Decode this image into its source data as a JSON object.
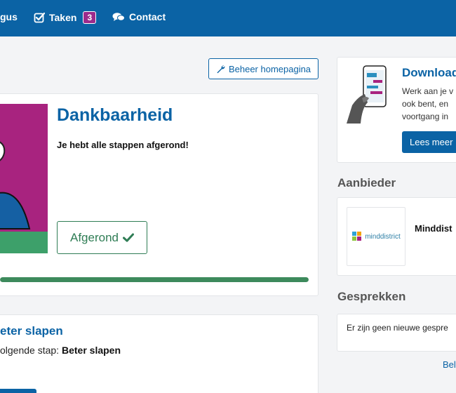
{
  "nav": {
    "items": [
      {
        "label": "gus",
        "icon": "none"
      },
      {
        "label": "Taken",
        "icon": "check-square-icon",
        "badge": "3"
      },
      {
        "label": "Contact",
        "icon": "chat-bubbles-icon"
      }
    ]
  },
  "toolbar": {
    "beheer_label": "Beheer homepagina"
  },
  "course": {
    "title": "Dankbaarheid",
    "message": "Je hebt alle stappen afgerond!",
    "status_button": "Afgerond",
    "progress": 1.0
  },
  "next_step": {
    "title": "eter slapen",
    "prefix": "olgende stap: ",
    "step_name": "Beter slapen"
  },
  "download": {
    "title": "Download",
    "lines": [
      "Werk aan je v",
      "ook bent, en",
      "voortgang in"
    ],
    "button": "Lees meer"
  },
  "provider": {
    "heading": "Aanbieder",
    "logo_text": "minddistrict",
    "name": "Minddist"
  },
  "conversations": {
    "heading": "Gesprekken",
    "empty_text": "Er zijn geen nieuwe gespre",
    "link": "Bel"
  },
  "colors": {
    "primary": "#0b63a5",
    "success": "#3d8a5c",
    "badge": "#9c2b8c",
    "illustration": "#a8237f"
  }
}
